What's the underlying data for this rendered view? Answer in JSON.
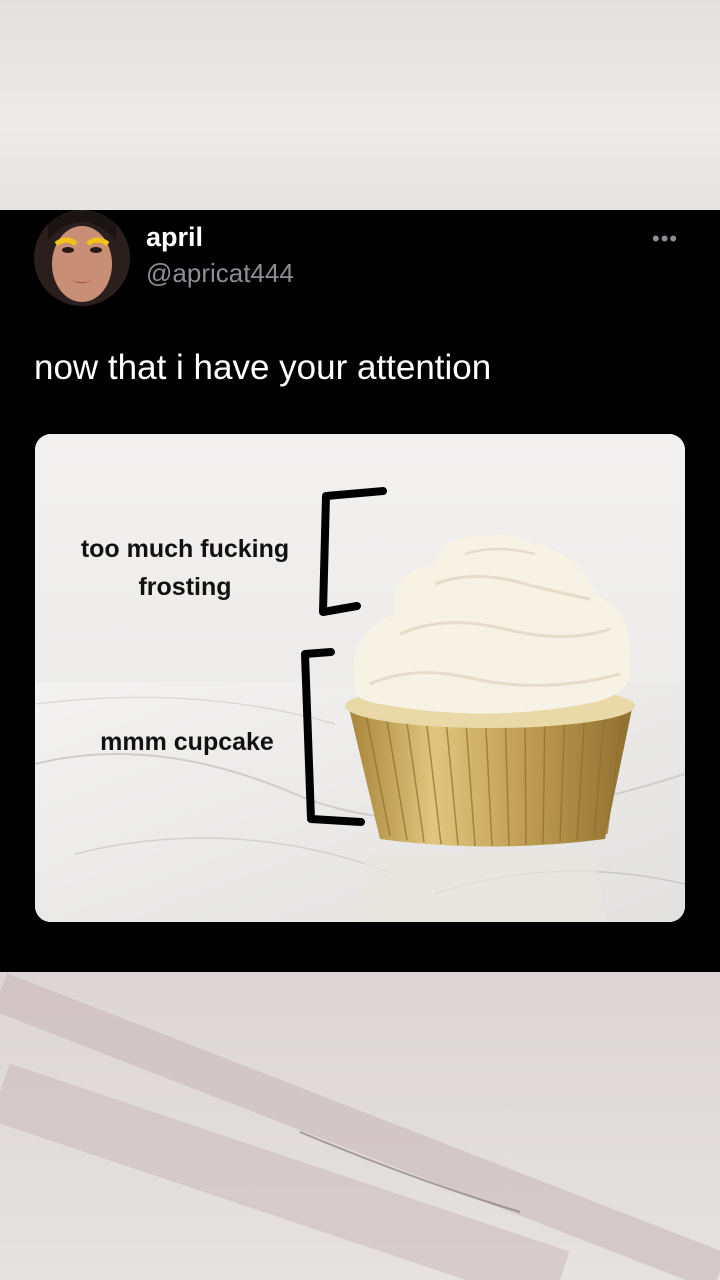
{
  "tweet": {
    "display_name": "april",
    "handle": "@apricat444",
    "more_icon": "•••",
    "text": "now that i have your attention",
    "media": {
      "label_frosting": "too much fucking frosting",
      "label_cupcake": "mmm cupcake"
    }
  },
  "colors": {
    "tweet_bg": "#000000",
    "text_primary": "#ffffff",
    "text_secondary": "#8b8f94",
    "liner_gold": "#c9a95a",
    "frosting": "#f6f2e4"
  }
}
